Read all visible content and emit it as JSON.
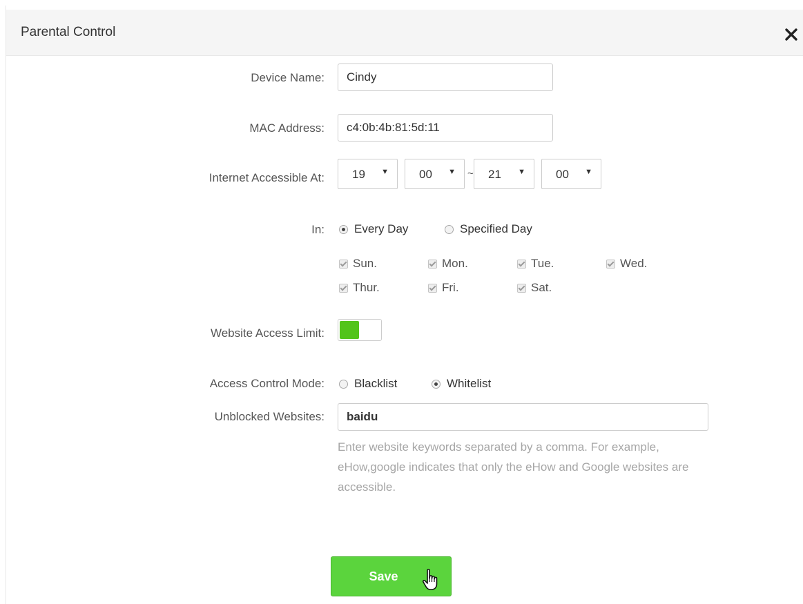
{
  "dialog": {
    "title": "Parental Control"
  },
  "form": {
    "device_name": {
      "label": "Device Name:",
      "value": "Cindy"
    },
    "mac_address": {
      "label": "MAC Address:",
      "value": "c4:0b:4b:81:5d:11"
    },
    "access_time": {
      "label": "Internet Accessible At:",
      "start_hour": "19",
      "start_minute": "00",
      "separator": "~",
      "end_hour": "21",
      "end_minute": "00"
    },
    "in": {
      "label": "In:",
      "options": [
        "Every Day",
        "Specified Day"
      ],
      "selected": "Every Day"
    },
    "days": [
      "Sun.",
      "Mon.",
      "Tue.",
      "Wed.",
      "Thur.",
      "Fri.",
      "Sat."
    ],
    "website_access_limit": {
      "label": "Website Access Limit:",
      "enabled": true
    },
    "access_control_mode": {
      "label": "Access Control Mode:",
      "options": [
        "Blacklist",
        "Whitelist"
      ],
      "selected": "Whitelist"
    },
    "unblocked_websites": {
      "label": "Unblocked Websites:",
      "value": "baidu",
      "hint": "Enter website keywords separated by a comma. For example, eHow,google indicates that only the eHow and Google websites are accessible."
    },
    "save_label": "Save"
  },
  "colors": {
    "accent_green": "#52c41a",
    "save_button": "#5bd43d",
    "hint_text": "#a6a6a6"
  },
  "icons": {
    "close": "close-icon",
    "cursor": "hand-pointer-icon",
    "dropdown": "chevron-down-icon"
  }
}
